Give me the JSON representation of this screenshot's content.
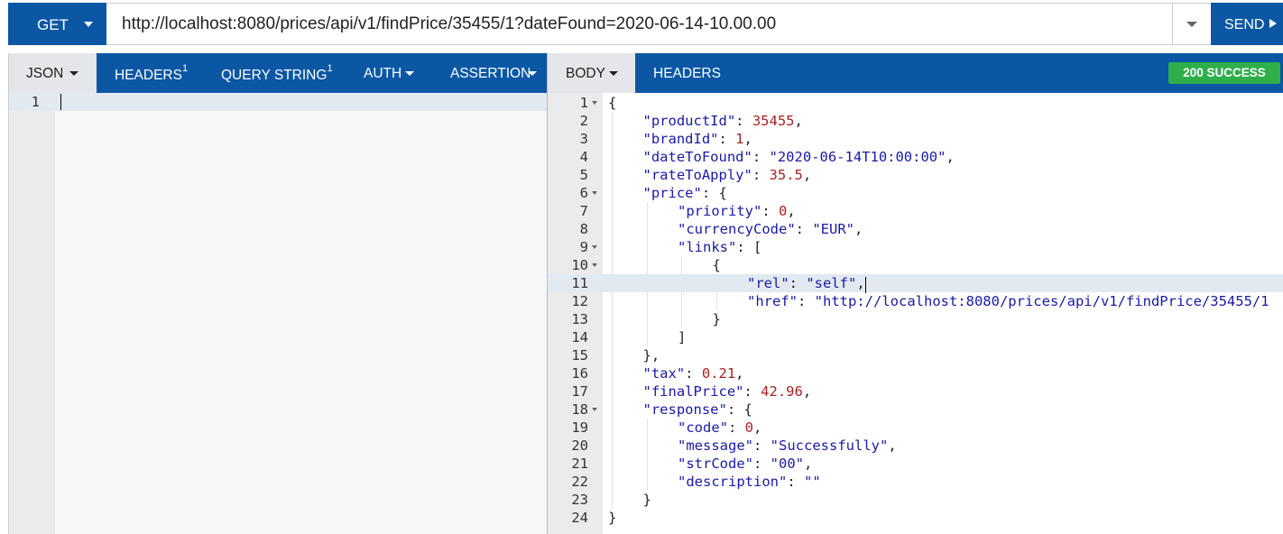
{
  "request": {
    "method": "GET",
    "url": "http://localhost:8080/prices/api/v1/findPrice/35455/1?dateFound=2020-06-14-10.00.00",
    "send_label": "SEND"
  },
  "left_tabs": {
    "json": "JSON",
    "headers": "HEADERS",
    "headers_count": "1",
    "query_string": "QUERY STRING",
    "query_string_count": "1",
    "auth": "AUTH",
    "assertion": "ASSERTION"
  },
  "request_editor": {
    "line_numbers": [
      "1"
    ]
  },
  "right_tabs": {
    "body": "BODY",
    "headers": "HEADERS",
    "status": "200 SUCCESS"
  },
  "response_lines": [
    {
      "n": "1",
      "fold": true,
      "indent": 0,
      "t": [
        [
          "p",
          "{"
        ]
      ]
    },
    {
      "n": "2",
      "fold": false,
      "indent": 1,
      "t": [
        [
          "k",
          "\"productId\""
        ],
        [
          "p",
          ": "
        ],
        [
          "n",
          "35455"
        ],
        [
          "p",
          ","
        ]
      ]
    },
    {
      "n": "3",
      "fold": false,
      "indent": 1,
      "t": [
        [
          "k",
          "\"brandId\""
        ],
        [
          "p",
          ": "
        ],
        [
          "n",
          "1"
        ],
        [
          "p",
          ","
        ]
      ]
    },
    {
      "n": "4",
      "fold": false,
      "indent": 1,
      "t": [
        [
          "k",
          "\"dateToFound\""
        ],
        [
          "p",
          ": "
        ],
        [
          "s",
          "\"2020-06-14T10:00:00\""
        ],
        [
          "p",
          ","
        ]
      ]
    },
    {
      "n": "5",
      "fold": false,
      "indent": 1,
      "t": [
        [
          "k",
          "\"rateToApply\""
        ],
        [
          "p",
          ": "
        ],
        [
          "n",
          "35.5"
        ],
        [
          "p",
          ","
        ]
      ]
    },
    {
      "n": "6",
      "fold": true,
      "indent": 1,
      "t": [
        [
          "k",
          "\"price\""
        ],
        [
          "p",
          ": {"
        ]
      ]
    },
    {
      "n": "7",
      "fold": false,
      "indent": 2,
      "t": [
        [
          "k",
          "\"priority\""
        ],
        [
          "p",
          ": "
        ],
        [
          "n",
          "0"
        ],
        [
          "p",
          ","
        ]
      ]
    },
    {
      "n": "8",
      "fold": false,
      "indent": 2,
      "t": [
        [
          "k",
          "\"currencyCode\""
        ],
        [
          "p",
          ": "
        ],
        [
          "s",
          "\"EUR\""
        ],
        [
          "p",
          ","
        ]
      ]
    },
    {
      "n": "9",
      "fold": true,
      "indent": 2,
      "t": [
        [
          "k",
          "\"links\""
        ],
        [
          "p",
          ": ["
        ]
      ]
    },
    {
      "n": "10",
      "fold": true,
      "indent": 3,
      "t": [
        [
          "p",
          "{"
        ]
      ]
    },
    {
      "n": "11",
      "fold": false,
      "indent": 4,
      "active": true,
      "t": [
        [
          "k",
          "\"rel\""
        ],
        [
          "p",
          ": "
        ],
        [
          "s",
          "\"self\""
        ],
        [
          "p",
          ","
        ]
      ]
    },
    {
      "n": "12",
      "fold": false,
      "indent": 4,
      "t": [
        [
          "k",
          "\"href\""
        ],
        [
          "p",
          ": "
        ],
        [
          "s",
          "\"http://localhost:8080/prices/api/v1/findPrice/35455/1"
        ]
      ]
    },
    {
      "n": "13",
      "fold": false,
      "indent": 3,
      "t": [
        [
          "p",
          "}"
        ]
      ]
    },
    {
      "n": "14",
      "fold": false,
      "indent": 2,
      "t": [
        [
          "p",
          "]"
        ]
      ]
    },
    {
      "n": "15",
      "fold": false,
      "indent": 1,
      "t": [
        [
          "p",
          "},"
        ]
      ]
    },
    {
      "n": "16",
      "fold": false,
      "indent": 1,
      "t": [
        [
          "k",
          "\"tax\""
        ],
        [
          "p",
          ": "
        ],
        [
          "n",
          "0.21"
        ],
        [
          "p",
          ","
        ]
      ]
    },
    {
      "n": "17",
      "fold": false,
      "indent": 1,
      "t": [
        [
          "k",
          "\"finalPrice\""
        ],
        [
          "p",
          ": "
        ],
        [
          "n",
          "42.96"
        ],
        [
          "p",
          ","
        ]
      ]
    },
    {
      "n": "18",
      "fold": true,
      "indent": 1,
      "t": [
        [
          "k",
          "\"response\""
        ],
        [
          "p",
          ": {"
        ]
      ]
    },
    {
      "n": "19",
      "fold": false,
      "indent": 2,
      "t": [
        [
          "k",
          "\"code\""
        ],
        [
          "p",
          ": "
        ],
        [
          "n",
          "0"
        ],
        [
          "p",
          ","
        ]
      ]
    },
    {
      "n": "20",
      "fold": false,
      "indent": 2,
      "t": [
        [
          "k",
          "\"message\""
        ],
        [
          "p",
          ": "
        ],
        [
          "s",
          "\"Successfully\""
        ],
        [
          "p",
          ","
        ]
      ]
    },
    {
      "n": "21",
      "fold": false,
      "indent": 2,
      "t": [
        [
          "k",
          "\"strCode\""
        ],
        [
          "p",
          ": "
        ],
        [
          "s",
          "\"00\""
        ],
        [
          "p",
          ","
        ]
      ]
    },
    {
      "n": "22",
      "fold": false,
      "indent": 2,
      "t": [
        [
          "k",
          "\"description\""
        ],
        [
          "p",
          ": "
        ],
        [
          "s",
          "\"\""
        ]
      ]
    },
    {
      "n": "23",
      "fold": false,
      "indent": 1,
      "t": [
        [
          "p",
          "}"
        ]
      ]
    },
    {
      "n": "24",
      "fold": false,
      "indent": 0,
      "t": [
        [
          "p",
          "}"
        ]
      ]
    }
  ]
}
